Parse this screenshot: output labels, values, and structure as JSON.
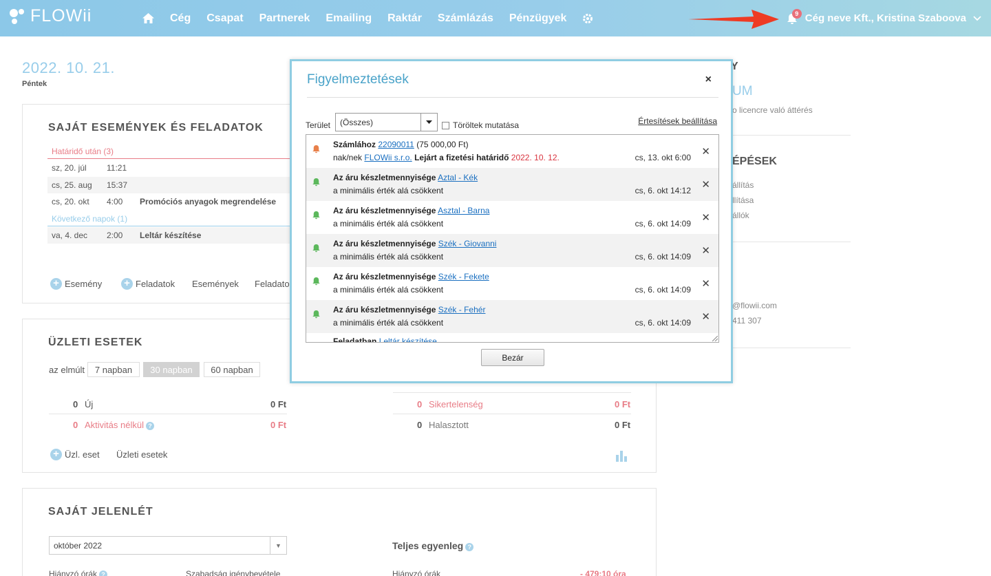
{
  "header": {
    "logo_text": "FLOWii",
    "nav": [
      "Cég",
      "Csapat",
      "Partnerek",
      "Emailing",
      "Raktár",
      "Számlázás",
      "Pénzügyek"
    ],
    "icons": {
      "home": "home-icon",
      "settings": "gear-icon",
      "bell": "bell-icon"
    },
    "notification_count": "9",
    "user_label": "Cég neve Kft., Kristina Szaboova"
  },
  "dashboard": {
    "date": "2022. 10. 21.",
    "day": "Péntek",
    "events": {
      "title": "SAJÁT ESEMÉNYEK ÉS FELADATOK",
      "section_overdue": "Határidő után (3)",
      "rows_overdue": [
        {
          "date": "sz, 20. júl",
          "time": "11:21",
          "name": ""
        },
        {
          "date": "cs, 25. aug",
          "time": "15:37",
          "name": ""
        },
        {
          "date": "cs, 20. okt",
          "time": "4:00",
          "name": "Promóciós anyagok megrendelése"
        }
      ],
      "section_next": "Következő napok (1)",
      "rows_next": [
        {
          "date": "va, 4. dec",
          "time": "2:00",
          "name": "Leltár készítése"
        }
      ],
      "links": [
        "Esemény",
        "Feladatok",
        "Események",
        "Feladato"
      ]
    },
    "business": {
      "title": "ÜZLETI ESETEK",
      "period_prefix": "az elmúlt",
      "periods": [
        "7 napban",
        "30 napban",
        "60 napban"
      ],
      "stats_left": [
        {
          "count": "0",
          "label": "Új",
          "amount": "0 Ft"
        },
        {
          "count": "0",
          "label": "Aktivitás nélkül",
          "amount": "0 Ft"
        }
      ],
      "stats_right": [
        {
          "count": "0",
          "label": "Sikertelenség",
          "amount": "0 Ft"
        },
        {
          "count": "0",
          "label": "Halasztott",
          "amount": "0 Ft"
        }
      ],
      "links": [
        "Üzl. eset",
        "Üzleti esetek"
      ]
    },
    "attendance": {
      "title": "SAJÁT JELENLÉT",
      "month": "október 2022",
      "balance_title": "Teljes egyenleg",
      "missing_hours": "Hiányzó órák",
      "vacation": "Szabadság igénybevétele",
      "missing_value": "- 479:10 óra"
    },
    "right_panel": {
      "fragments": [
        "Y",
        "UM",
        "o licencre való áttérés",
        "ÉPÉSEK",
        "állítás",
        "llítása",
        "állók",
        "@flowii.com",
        "411 307"
      ]
    }
  },
  "modal": {
    "title": "Figyelmeztetések",
    "filter_label": "Terület",
    "filter_value": "(Összes)",
    "show_deleted": "Töröltek mutatása",
    "settings_link": "Értesítések beállítása",
    "close_button": "Bezár",
    "colors": {
      "alert": "#e8804a",
      "ok": "#5cb85c",
      "accent": "#4aa3c9"
    },
    "items": [
      {
        "icon": "bell-icon-orange",
        "bold1": "Számlához",
        "link1": "22090011",
        "rest1": "(75 000,00 Ft)",
        "pre2": "nak/nek",
        "link2": "FLOWii s.r.o.",
        "bold2": "Lejárt a fizetési határidő",
        "red2": "2022. 10. 12.",
        "time": "cs, 13. okt 6:00"
      },
      {
        "icon": "bell-icon-green",
        "bold1": "Az áru készletmennyisége",
        "link1": "Aztal - Kék",
        "text2": "a minimális érték alá csökkent",
        "time": "cs, 6. okt 14:12"
      },
      {
        "icon": "bell-icon-green",
        "bold1": "Az áru készletmennyisége",
        "link1": "Asztal - Barna",
        "text2": "a minimális érték alá csökkent",
        "time": "cs, 6. okt 14:09"
      },
      {
        "icon": "bell-icon-green",
        "bold1": "Az áru készletmennyisége",
        "link1": "Szék - Giovanni",
        "text2": "a minimális érték alá csökkent",
        "time": "cs, 6. okt 14:09"
      },
      {
        "icon": "bell-icon-green",
        "bold1": "Az áru készletmennyisége",
        "link1": "Szék - Fekete",
        "text2": "a minimális érték alá csökkent",
        "time": "cs, 6. okt 14:09"
      },
      {
        "icon": "bell-icon-green",
        "bold1": "Az áru készletmennyisége",
        "link1": "Szék - Fehér",
        "text2": "a minimális érték alá csökkent",
        "time": "cs, 6. okt 14:09"
      },
      {
        "icon": "bell-icon-green",
        "bold1": "Feladatban",
        "link1": "Leltár készítése"
      }
    ]
  }
}
